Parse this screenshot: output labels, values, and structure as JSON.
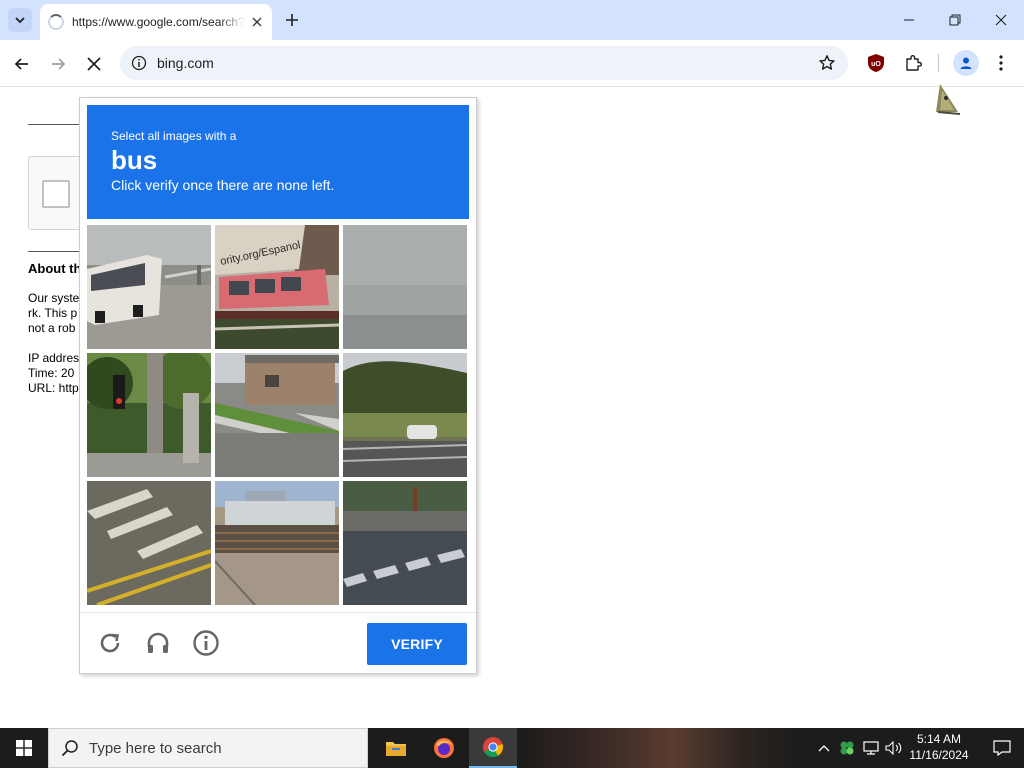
{
  "browser": {
    "tab_title": "https://www.google.com/search?q=",
    "url": "bing.com"
  },
  "page": {
    "about_heading": "About th",
    "about_lines": [
      "Our syste",
      "rk. This p",
      "not a rob"
    ],
    "info_lines": [
      "IP addres",
      "Time: 20",
      "URL: http"
    ]
  },
  "challenge": {
    "instruction": "Select all images with a",
    "target": "bus",
    "hint": "Click verify once there are none left.",
    "verify_label": "VERIFY",
    "accent_color": "#1a73e8",
    "tiles": [
      "bus-rear-parking-lot",
      "pink-bus-with-sign",
      "overcast-sky",
      "traffic-light-trees",
      "house-sidewalk",
      "hillside-road-car",
      "road-markings",
      "fenced-building-lot",
      "crosswalk-street"
    ]
  },
  "taskbar": {
    "search_placeholder": "Type here to search",
    "time": "5:14 AM",
    "date": "11/16/2024"
  }
}
